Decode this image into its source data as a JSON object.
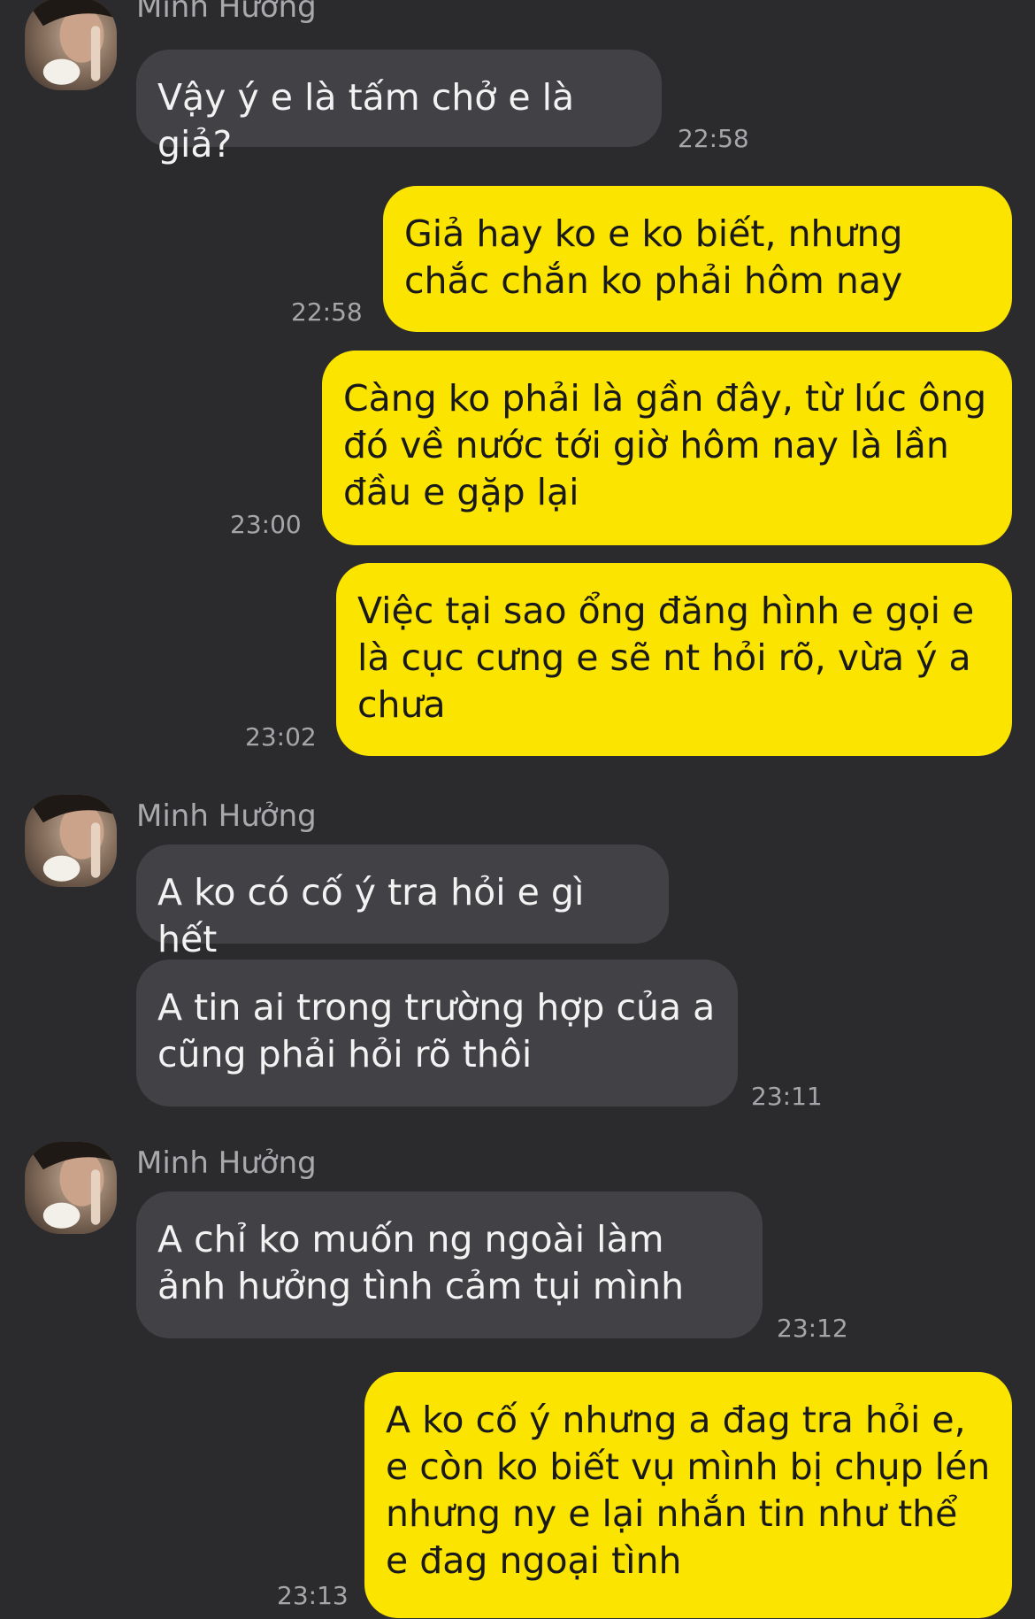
{
  "messages": [
    {
      "sender": "Minh Hưởng",
      "text": "Vậy ý e là tấm chở e là giả?",
      "time": "22:58"
    },
    {
      "text": "Giả hay ko e ko biết, nhưng chắc chắn ko phải hôm nay",
      "time": "22:58"
    },
    {
      "text": "Càng ko phải là gần đây, từ lúc ông đó về nước tới giờ hôm nay là lần đầu e gặp lại",
      "time": "23:00"
    },
    {
      "text": "Việc tại sao ổng đăng hình e gọi e là cục cưng e sẽ nt hỏi rõ, vừa ý a chưa",
      "time": "23:02"
    },
    {
      "sender": "Minh Hưởng",
      "text": "A ko có cố ý tra hỏi e gì hết"
    },
    {
      "text": "A tin ai trong trường hợp của a cũng phải hỏi rõ thôi",
      "time": "23:11"
    },
    {
      "sender": "Minh Hưởng",
      "text": "A chỉ ko muốn ng ngoài làm ảnh hưởng tình cảm tụi mình",
      "time": "23:12"
    },
    {
      "text": "A ko cố ý nhưng a đag tra hỏi e, e còn ko biết vụ mình bị chụp lén nhưng ny e lại nhắn tin như thể e đag ngoại tình",
      "time": "23:13"
    }
  ],
  "colors": {
    "background": "#2b2b2d",
    "incoming_bubble": "#424246",
    "outgoing_bubble": "#fbe400",
    "timestamp": "#a6a6aa"
  }
}
